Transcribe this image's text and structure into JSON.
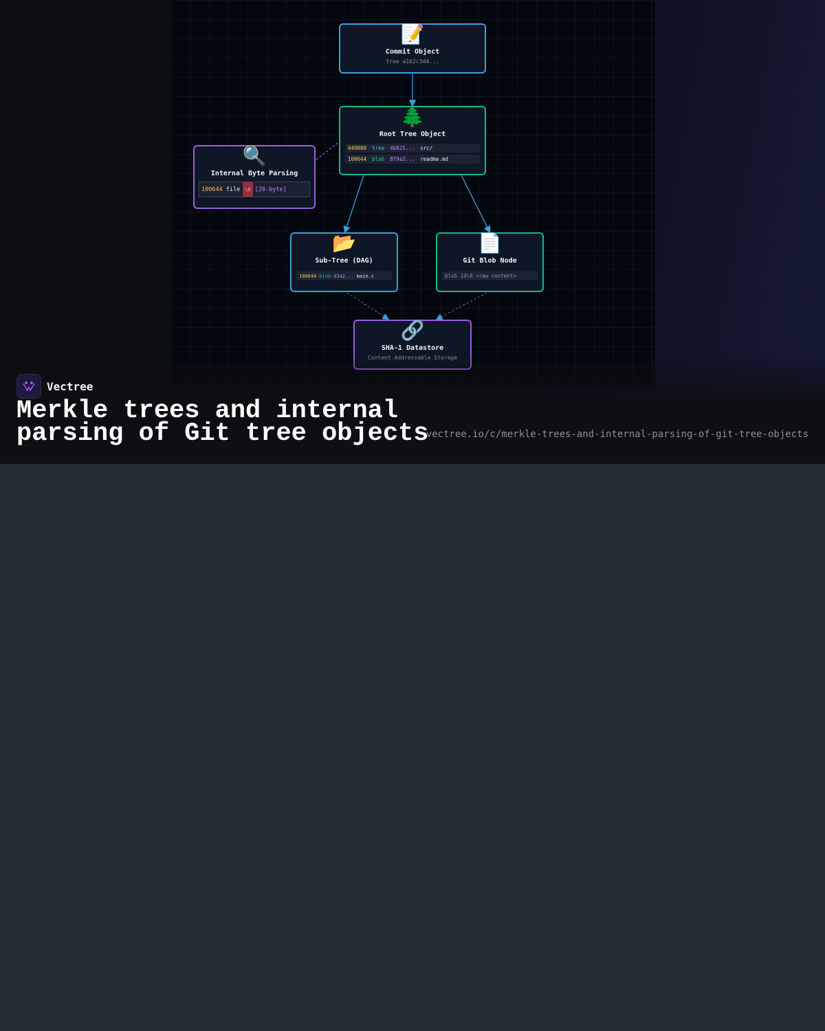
{
  "colors": {
    "accent_blue": "#3b9fe0",
    "accent_green": "#14b88a",
    "accent_purple": "#9b5de5",
    "mode_yellow": "#f5c451",
    "hash_purple": "#c084fc",
    "page_bg": "#252c35"
  },
  "diagram": {
    "commit": {
      "icon": "📝",
      "icon_name": "memo-icon",
      "title": "Commit Object",
      "subtitle": "tree a1b2c3d4..."
    },
    "root_tree": {
      "icon": "🌲",
      "icon_name": "evergreen-tree-icon",
      "title": "Root Tree Object",
      "entries": [
        {
          "mode": "040000",
          "type": "tree",
          "hash": "4b825...",
          "name": "src/"
        },
        {
          "mode": "100644",
          "type": "blob",
          "hash": "8f9a2...",
          "name": "readme.md"
        }
      ]
    },
    "byte_parsing": {
      "icon": "🔍",
      "icon_name": "magnifier-icon",
      "title": "Internal Byte Parsing",
      "mode": "100644",
      "name": "file",
      "null": "\\0",
      "sha": "[20-byte]"
    },
    "subtree": {
      "icon": "📂",
      "icon_name": "open-folder-icon",
      "title": "Sub-Tree (DAG)",
      "entries": [
        {
          "mode": "100644",
          "type": "blob",
          "hash": "d3a2...",
          "name": "main.c"
        }
      ]
    },
    "blob": {
      "icon": "📄",
      "icon_name": "document-icon",
      "title": "Git Blob Node",
      "content": "blob 14\\0 <raw content>"
    },
    "datastore": {
      "icon": "🔗",
      "icon_name": "link-icon",
      "title": "SHA-1 Datastore",
      "subtitle": "Content-Addressable Storage"
    }
  },
  "brand": {
    "name": "Vectree",
    "logo_icon": "vectree-logo-icon"
  },
  "title": "Merkle trees and internal parsing of Git tree objects",
  "url": "vectree.io/c/merkle-trees-and-internal-parsing-of-git-tree-objects"
}
